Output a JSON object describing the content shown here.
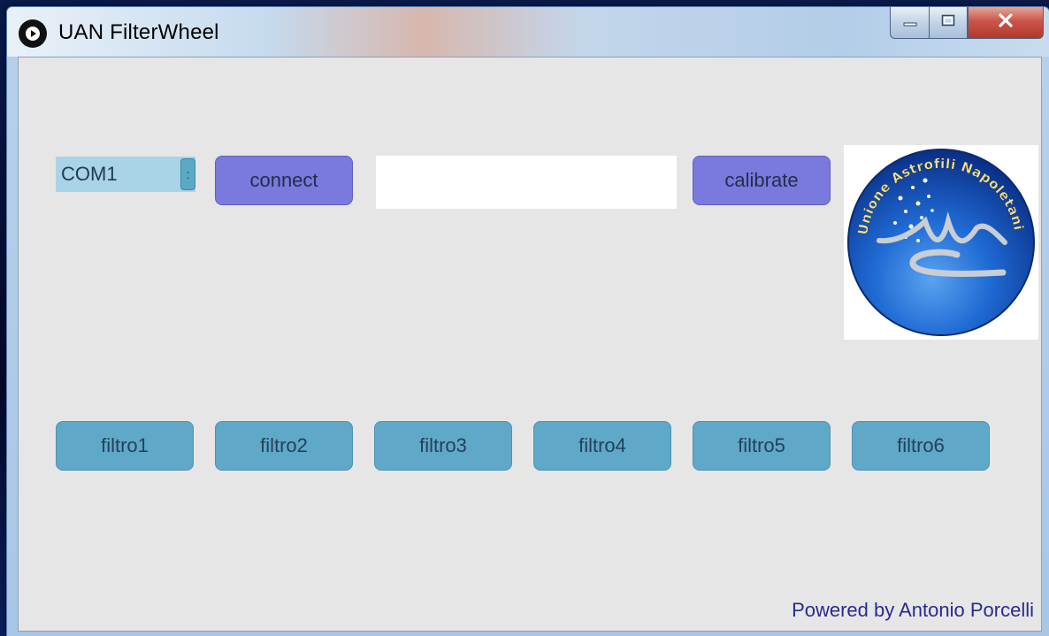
{
  "window": {
    "title": "UAN FilterWheel",
    "icon": "play-icon"
  },
  "window_controls": {
    "minimize_icon": "minimize-icon",
    "maximize_icon": "maximize-icon",
    "close_icon": "close-icon"
  },
  "toolbar": {
    "port_select": {
      "value": "COM1",
      "arrow": ":"
    },
    "connect_label": "connect",
    "status_value": "",
    "calibrate_label": "calibrate"
  },
  "logo": {
    "text": "Unione Astrofili Napoletani",
    "mark": "UAN"
  },
  "filters": [
    {
      "label": "filtro1"
    },
    {
      "label": "filtro2"
    },
    {
      "label": "filtro3"
    },
    {
      "label": "filtro4"
    },
    {
      "label": "filtro5"
    },
    {
      "label": "filtro6"
    }
  ],
  "footer": {
    "credit": "Powered by Antonio Porcelli"
  },
  "colors": {
    "connect_button": "#7a79dd",
    "filter_button": "#5fa8c8",
    "client_background": "#e6e6e6",
    "credit_text": "#2a2a8c"
  }
}
